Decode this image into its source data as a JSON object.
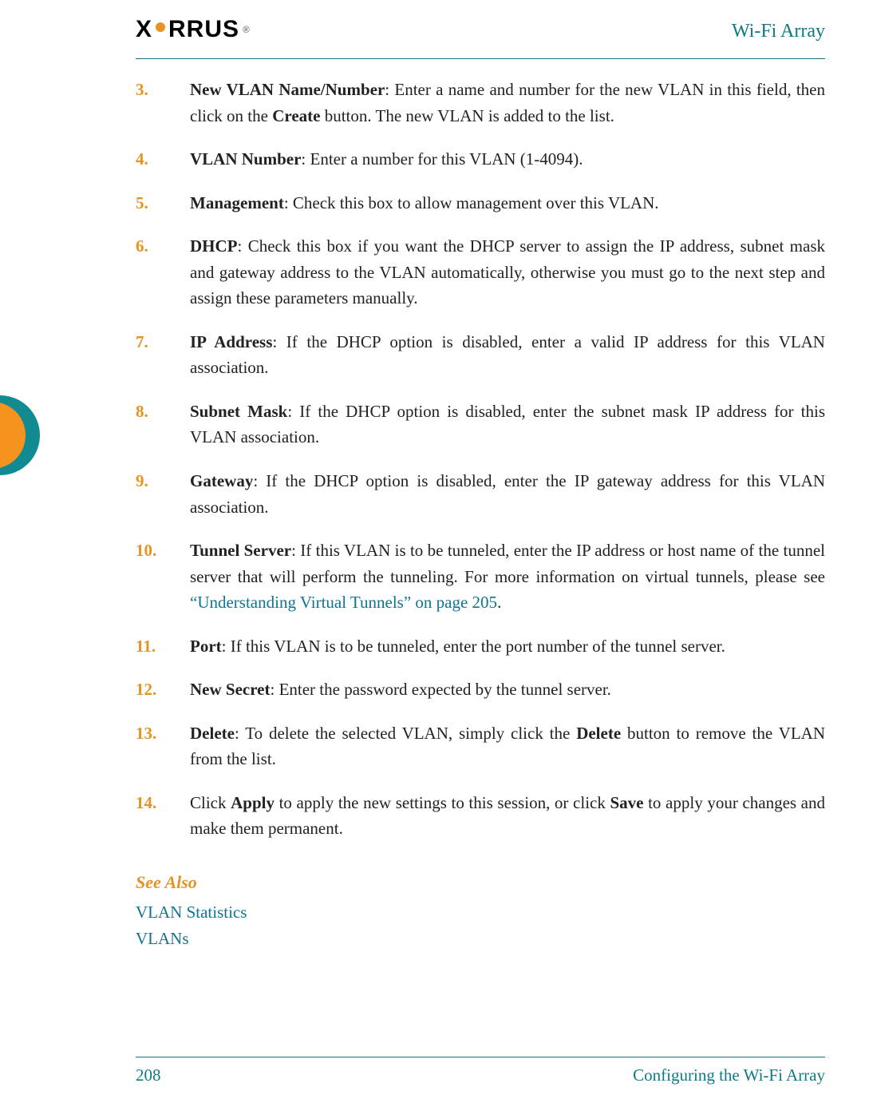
{
  "header": {
    "logo_text_left": "X",
    "logo_text_right": "RRUS",
    "logo_tm": "®",
    "title": "Wi-Fi Array"
  },
  "steps": [
    {
      "n": "3.",
      "term": "New VLAN Name/Number",
      "t1": ": Enter a name and number for the new VLAN in this field, then click on the ",
      "b1": "Create",
      "t2": " button. The new VLAN is added to the list."
    },
    {
      "n": "4.",
      "term": "VLAN Number",
      "t1": ": Enter a number for this VLAN (1-4094)."
    },
    {
      "n": "5.",
      "term": "Management",
      "t1": ": Check this box to allow management over this VLAN."
    },
    {
      "n": "6.",
      "term": "DHCP",
      "t1": ": Check this box if you want the DHCP server to assign the IP address, subnet mask and gateway address to the VLAN automatically, otherwise you must go to the next step and assign these parameters manually."
    },
    {
      "n": "7.",
      "term": "IP Address",
      "t1": ": If the DHCP option is disabled, enter a valid IP address for this VLAN association."
    },
    {
      "n": "8.",
      "term": "Subnet Mask",
      "t1": ": If the DHCP option is disabled, enter the subnet mask IP address for this VLAN association."
    },
    {
      "n": "9.",
      "term": "Gateway",
      "t1": ": If the DHCP option is disabled, enter the IP gateway address for this VLAN association."
    },
    {
      "n": "10.",
      "term": "Tunnel Server",
      "t1": ": If this VLAN is to be tunneled, enter the IP address or host name of the tunnel server that will perform the tunneling. For more information on virtual tunnels, please see ",
      "x": "“Understanding Virtual Tunnels” on page 205",
      "t2": "."
    },
    {
      "n": "11.",
      "term": "Port",
      "t1": ": If this VLAN is to be tunneled, enter the port number of the tunnel server."
    },
    {
      "n": "12.",
      "term": "New Secret",
      "t1": ": Enter the password expected by the tunnel server."
    },
    {
      "n": "13.",
      "term": "Delete",
      "t1": ": To delete the selected VLAN, simply click the ",
      "b1": "Delete",
      "t2": " button to remove the VLAN from the list."
    },
    {
      "n": "14.",
      "term": "",
      "t1": "Click ",
      "b1": "Apply",
      "t2": " to apply the new settings to this session, or click ",
      "b2": "Save",
      "t3": " to apply your changes and make them permanent."
    }
  ],
  "see_also": {
    "heading": "See Also",
    "links": [
      "VLAN Statistics",
      "VLANs"
    ]
  },
  "footer": {
    "page": "208",
    "section": "Configuring the Wi-Fi Array"
  }
}
